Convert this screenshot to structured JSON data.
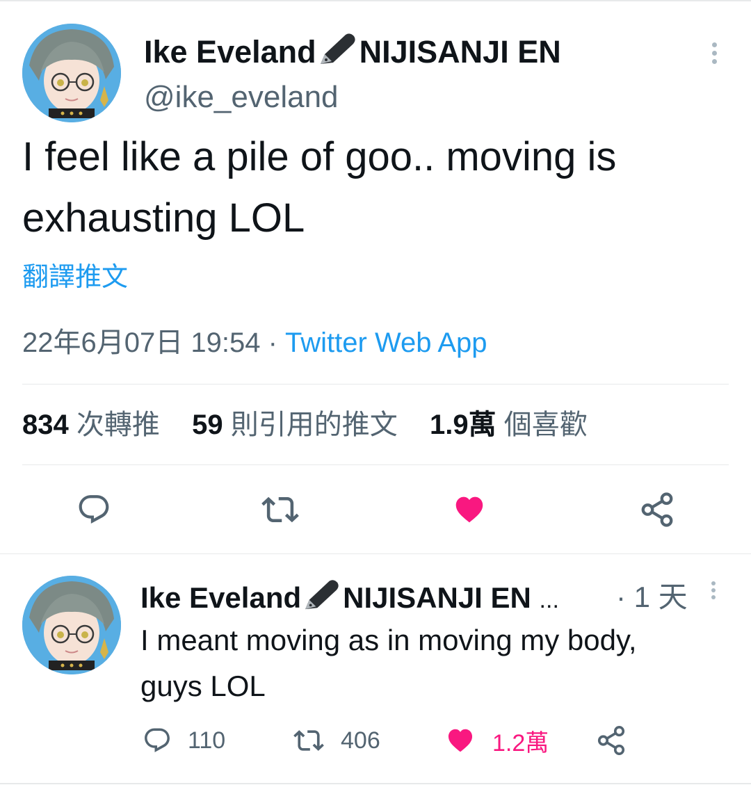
{
  "main_tweet": {
    "display_name": "Ike Eveland",
    "name_suffix": "NIJISANJI EN",
    "handle": "@ike_eveland",
    "text_line1": "I feel like a pile of goo.. moving is",
    "text_line2": "exhausting LOL",
    "translate_label": "翻譯推文",
    "timestamp": "22年6月07日 19:54",
    "separator": "·",
    "source": "Twitter Web App",
    "stats": {
      "retweets_count": "834",
      "retweets_label": "次轉推",
      "quotes_count": "59",
      "quotes_label": "則引用的推文",
      "likes_count": "1.9萬",
      "likes_label": "個喜歡"
    }
  },
  "reply_tweet": {
    "display_name": "Ike Eveland",
    "name_suffix": "NIJISANJI EN",
    "ellipsis": "...",
    "time": "· 1 天",
    "text_line1": "I meant moving as in moving my body,",
    "text_line2": "guys LOL",
    "reply_count": "110",
    "retweet_count": "406",
    "like_count": "1.2萬"
  },
  "icons": {
    "name_badge": "pen-nib-icon",
    "more": "more-vertical-icon",
    "reply": "reply-icon",
    "retweet": "retweet-icon",
    "like": "heart-icon",
    "share": "share-icon"
  },
  "colors": {
    "link": "#1d9bf0",
    "like": "#f91880",
    "text": "#0f1419",
    "secondary": "#536471"
  }
}
